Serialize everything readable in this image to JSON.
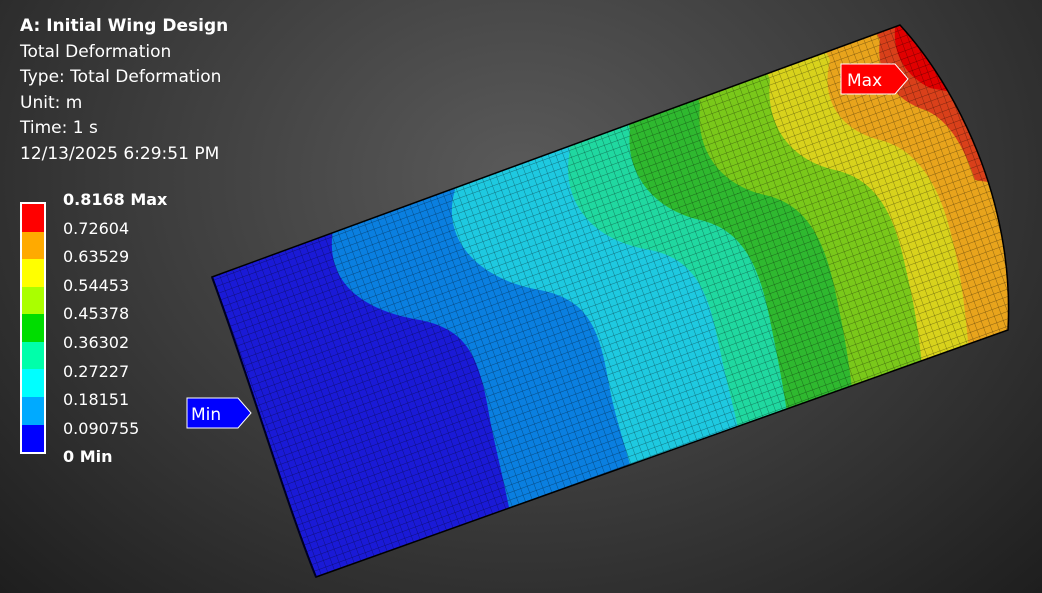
{
  "result": {
    "title": "A: Initial Wing Design",
    "name": "Total Deformation",
    "type": "Type: Total Deformation",
    "unit": "Unit: m",
    "time": "Time: 1 s",
    "timestamp": "12/13/2025 6:29:51 PM"
  },
  "legend": {
    "labels": [
      "0.8168 Max",
      "0.72604",
      "0.63529",
      "0.54453",
      "0.45378",
      "0.36302",
      "0.27227",
      "0.18151",
      "0.090755",
      "0 Min"
    ],
    "colors": [
      "#ff0000",
      "#ffaa00",
      "#ffff00",
      "#aaff00",
      "#00dd00",
      "#00ffaa",
      "#00ffff",
      "#00aaff",
      "#0000ff"
    ]
  },
  "probes": {
    "max_label": "Max",
    "min_label": "Min",
    "max_color": "#ff0000",
    "min_color": "#0000ff"
  },
  "icons": {
    "max_probe": "flag-pointer-icon",
    "min_probe": "flag-pointer-icon"
  }
}
